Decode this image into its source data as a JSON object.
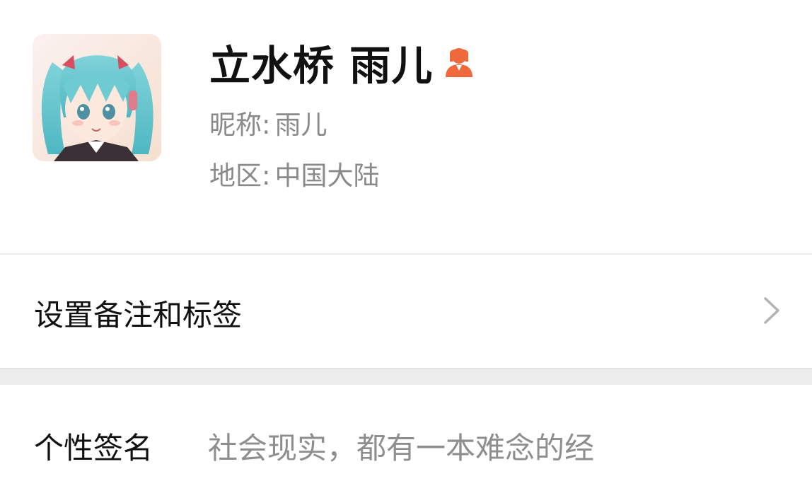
{
  "profile": {
    "display_name": "立水桥 雨儿",
    "gender_icon": "female-user-icon",
    "nickname_label": "昵称:",
    "nickname": "雨儿",
    "region_label": "地区:",
    "region": "中国大陆",
    "avatar": "anime-girl-avatar"
  },
  "remark": {
    "label": "设置备注和标签",
    "chevron_icon": "chevron-right-icon"
  },
  "signature": {
    "label": "个性签名",
    "value": "社会现实，都有一本难念的经"
  },
  "colors": {
    "accent_icon": "#ee6a3c",
    "title_text": "#111111",
    "secondary_text": "#8a8a8a",
    "divider": "#ececec",
    "section_gap": "#ededed"
  }
}
